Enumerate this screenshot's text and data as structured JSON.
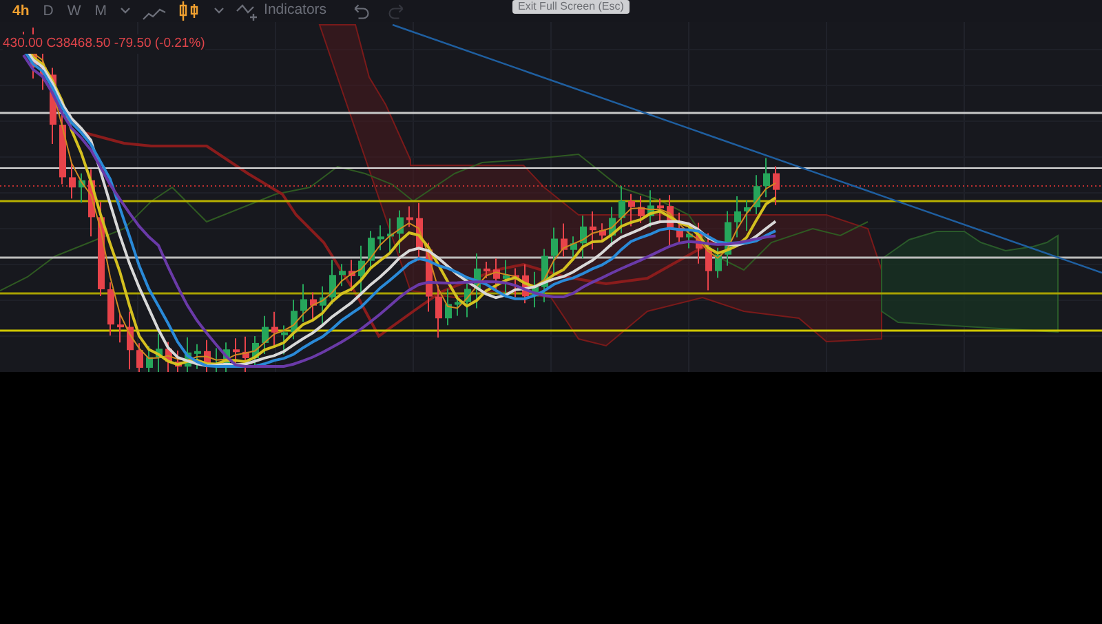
{
  "toolbar": {
    "intervals": [
      {
        "label": "4h",
        "selected": true
      },
      {
        "label": "D",
        "selected": false
      },
      {
        "label": "W",
        "selected": false
      },
      {
        "label": "M",
        "selected": false
      }
    ],
    "chart_types": [
      {
        "kind": "line",
        "selected": false
      },
      {
        "kind": "candles",
        "selected": true
      }
    ],
    "indicators_label": "Indicators",
    "undo": {
      "disabled": false
    },
    "redo": {
      "disabled": true
    }
  },
  "tooltip": "Exit Full Screen (Esc)",
  "legend": {
    "open_tail": "430.00",
    "close": "C38468.50",
    "change": "-79.50 (-0.21%)"
  }
}
